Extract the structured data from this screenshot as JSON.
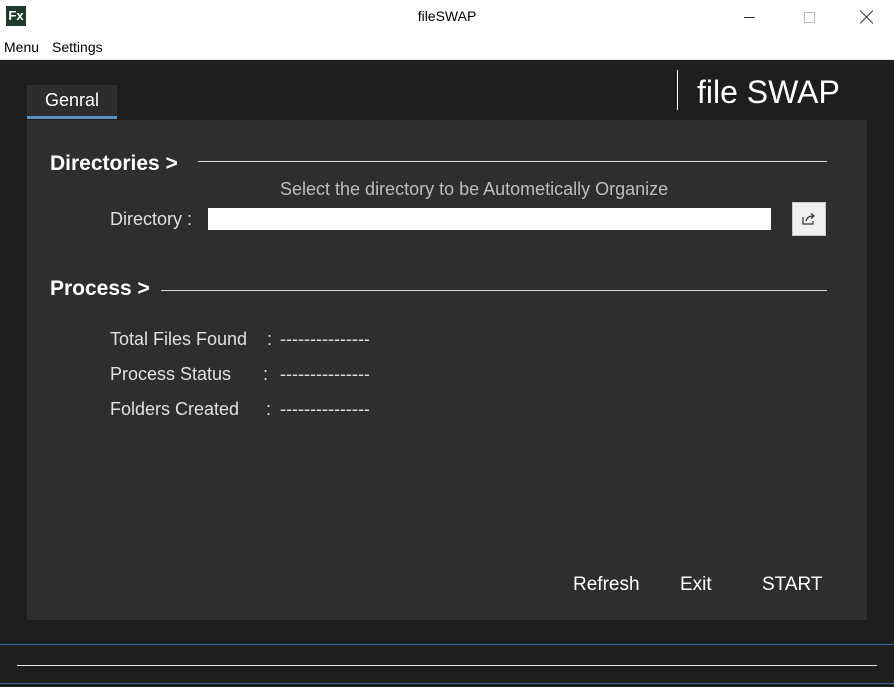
{
  "window": {
    "icon_text": "Fx",
    "title": "fileSWAP"
  },
  "menubar": {
    "items": [
      "Menu",
      "Settings"
    ]
  },
  "brand": {
    "title": "file SWAP"
  },
  "tabs": [
    {
      "label": "Genral",
      "active": true
    }
  ],
  "directories": {
    "heading": "Directories  >",
    "hint": "Select the directory to be Autometically Organize",
    "directory_label": "Directory :",
    "directory_value": ""
  },
  "process": {
    "heading": "Process  >",
    "stats": [
      {
        "label": "Total Files Found",
        "colon": ":",
        "value": "---------------"
      },
      {
        "label": "Process Status",
        "colon": ":",
        "value": "---------------"
      },
      {
        "label": "Folders Created",
        "colon": ":",
        "value": "---------------"
      }
    ]
  },
  "actions": {
    "refresh": "Refresh",
    "exit": "Exit",
    "start": "START"
  },
  "colors": {
    "background": "#1e1e1e",
    "panel": "#2e2e2e",
    "accent": "#5b8fbf"
  }
}
